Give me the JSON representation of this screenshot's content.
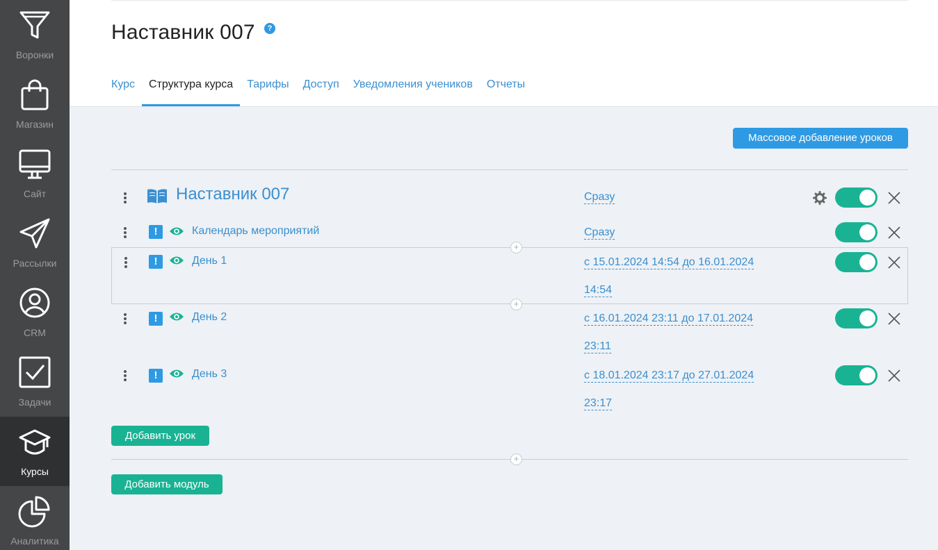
{
  "sidebar": {
    "items": [
      {
        "label": "Воронки",
        "icon": "funnel-icon"
      },
      {
        "label": "Магазин",
        "icon": "shopping-bag-icon"
      },
      {
        "label": "Сайт",
        "icon": "monitor-icon"
      },
      {
        "label": "Рассылки",
        "icon": "paper-plane-icon"
      },
      {
        "label": "CRM",
        "icon": "user-circle-icon"
      },
      {
        "label": "Задачи",
        "icon": "checkbox-icon"
      },
      {
        "label": "Курсы",
        "icon": "graduation-cap-icon",
        "active": true
      },
      {
        "label": "Аналитика",
        "icon": "pie-chart-icon"
      }
    ]
  },
  "header": {
    "title": "Наставник 007",
    "help": "?",
    "tabs": [
      {
        "label": "Курс"
      },
      {
        "label": "Структура курса",
        "active": true
      },
      {
        "label": "Тарифы"
      },
      {
        "label": "Доступ"
      },
      {
        "label": "Уведомления учеников"
      },
      {
        "label": "Отчеты"
      }
    ]
  },
  "toolbar": {
    "mass_add_label": "Массовое добавление уроков"
  },
  "module": {
    "title": "Наставник 007",
    "schedule": "Сразу",
    "enabled": true
  },
  "lessons": [
    {
      "title": "Календарь мероприятий",
      "schedule_line1": "Сразу",
      "schedule_line2": "",
      "enabled": true,
      "warn": "!"
    },
    {
      "title": "День 1",
      "schedule_line1": "с 15.01.2024 14:54 до 16.01.2024",
      "schedule_line2": "14:54",
      "enabled": true,
      "warn": "!"
    },
    {
      "title": "День 2",
      "schedule_line1": "с 16.01.2024 23:11 до 17.01.2024",
      "schedule_line2": "23:11",
      "enabled": true,
      "warn": "!"
    },
    {
      "title": "День 3",
      "schedule_line1": "с 18.01.2024 23:17 до 27.01.2024",
      "schedule_line2": "23:17",
      "enabled": true,
      "warn": "!"
    }
  ],
  "actions": {
    "add_lesson_label": "Добавить урок",
    "add_module_label": "Добавить модуль"
  },
  "colors": {
    "accent_blue": "#2e9ae3",
    "link_blue": "#3a8fd0",
    "toggle_green": "#19b394",
    "sidebar_bg": "#444648",
    "page_bg": "#eef1f5"
  }
}
